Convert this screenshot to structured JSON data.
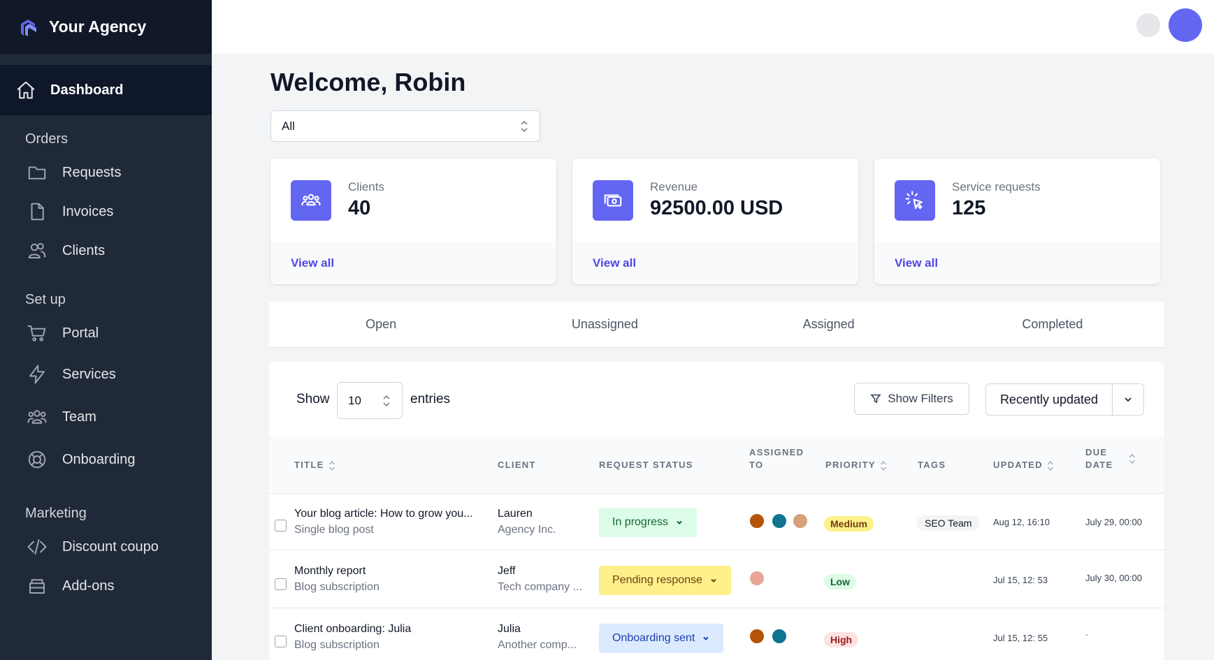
{
  "brand": {
    "name": "Your Agency"
  },
  "sidebar": {
    "active": {
      "label": "Dashboard",
      "icon": "home-icon"
    },
    "sections": [
      {
        "title": "Orders",
        "items": [
          {
            "label": "Requests",
            "icon": "folder-icon"
          },
          {
            "label": "Invoices",
            "icon": "document-icon"
          },
          {
            "label": "Clients",
            "icon": "users-icon"
          }
        ]
      },
      {
        "title": "Set up",
        "items": [
          {
            "label": "Portal",
            "icon": "cart-icon"
          },
          {
            "label": "Services",
            "icon": "bolt-icon"
          },
          {
            "label": "Team",
            "icon": "team-icon"
          },
          {
            "label": "Onboarding",
            "icon": "lifebuoy-icon"
          }
        ]
      },
      {
        "title": "Marketing",
        "items": [
          {
            "label": "Discount coupo",
            "icon": "code-icon"
          },
          {
            "label": "Add-ons",
            "icon": "archive-icon"
          }
        ]
      }
    ]
  },
  "header": {
    "welcome": "Welcome, Robin"
  },
  "filter": {
    "value": "All"
  },
  "stats": [
    {
      "label": "Clients",
      "value": "40",
      "link": "View all",
      "icon": "users-group-icon"
    },
    {
      "label": "Revenue",
      "value": "92500.00 USD",
      "link": "View all",
      "icon": "cash-icon"
    },
    {
      "label": "Service requests",
      "value": "125",
      "link": "View all",
      "icon": "cursor-click-icon"
    }
  ],
  "tabs": [
    "Open",
    "Unassigned",
    "Assigned",
    "Completed"
  ],
  "table": {
    "show_label": "Show",
    "entries_value": "10",
    "entries_label": "entries",
    "show_filters": "Show Filters",
    "sort_by": "Recently updated",
    "columns": {
      "title": "TITLE",
      "client": "CLIENT",
      "status": "REQUEST STATUS",
      "assigned_1": "ASSIGNED",
      "assigned_2": "TO",
      "priority": "PRIORITY",
      "tags": "TAGS",
      "updated": "UPDATED",
      "due_1": "DUE",
      "due_2": "DATE"
    },
    "rows": [
      {
        "title": "Your blog article: How to grow you...",
        "subtitle": "Single blog post",
        "client": "Lauren",
        "client_company": "Agency Inc.",
        "status": "In progress",
        "priority": "Medium",
        "tag": "SEO Team",
        "updated": "Aug 12, 16:10",
        "due": "July 29, 00:00"
      },
      {
        "title": "Monthly report",
        "subtitle": "Blog subscription",
        "client": "Jeff",
        "client_company": "Tech company ...",
        "status": "Pending response",
        "priority": "Low",
        "tag": "",
        "updated": "Jul 15, 12: 53",
        "due": "July 30, 00:00"
      },
      {
        "title": "Client onboarding: Julia",
        "subtitle": "Blog subscription",
        "client": "Julia",
        "client_company": "Another comp...",
        "status": "Onboarding sent",
        "priority": "High",
        "tag": "",
        "updated": "Jul 15, 12: 55",
        "due": "."
      }
    ]
  },
  "colors": {
    "accent": "#6366f1",
    "sidebar": "#1f2937",
    "status_in_progress": "#dcfce7",
    "status_pending": "#fef08a",
    "status_onboarding": "#dbeafe"
  }
}
